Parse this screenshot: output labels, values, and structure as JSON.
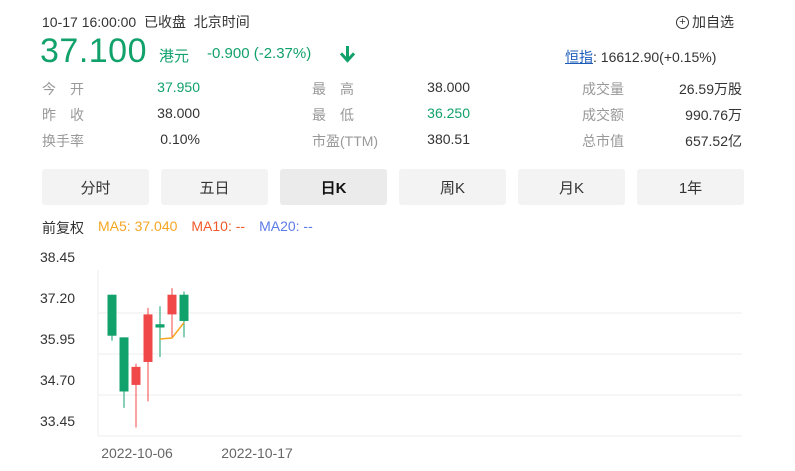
{
  "header": {
    "datetime": "10-17 16:00:00",
    "status": "已收盘",
    "tz": "北京时间",
    "watch_icon": "plus-circle-icon",
    "watch_label": "加自选"
  },
  "quote": {
    "price": "37.100",
    "currency": "港元",
    "change": "-0.900 (-2.37%)",
    "direction_icon": "arrow-down-icon",
    "index_name": "恒指",
    "index_value": ": 16612.90(+0.15%)"
  },
  "stats": [
    {
      "label": "今　开",
      "value": "37.950",
      "color": "#11a16b"
    },
    {
      "label": "最　高",
      "value": "38.000",
      "color": "#333333"
    },
    {
      "label": "成交量",
      "value": "26.59万股",
      "color": "#333333"
    },
    {
      "label": "昨　收",
      "value": "38.000",
      "color": "#333333"
    },
    {
      "label": "最　低",
      "value": "36.250",
      "color": "#11a16b"
    },
    {
      "label": "成交额",
      "value": "990.76万",
      "color": "#333333"
    },
    {
      "label": "换手率",
      "value": "0.10%",
      "color": "#333333"
    },
    {
      "label": "市盈(TTM)",
      "value": "380.51",
      "color": "#333333"
    },
    {
      "label": "总市值",
      "value": "657.52亿",
      "color": "#333333"
    }
  ],
  "tabs": [
    "分时",
    "五日",
    "日K",
    "周K",
    "月K",
    "1年"
  ],
  "active_tab": "日K",
  "legend": {
    "adjust": "前复权",
    "ma5": "MA5: 37.040",
    "ma10": "MA10: --",
    "ma20": "MA20: --"
  },
  "colors": {
    "up": "#f04848",
    "down": "#11a16b",
    "ma5": "#f5a623",
    "grid": "#eeeeee"
  },
  "chart_data": {
    "type": "candlestick",
    "y_ticks": [
      "38.45",
      "37.20",
      "35.95",
      "34.70",
      "33.45"
    ],
    "ylim": [
      33.45,
      38.45
    ],
    "x_ticks": [
      "2022-10-06",
      "2022-10-17"
    ],
    "candles": [
      {
        "open": 37.3,
        "close": 36.05,
        "high": 37.3,
        "low": 35.9
      },
      {
        "open": 36.0,
        "close": 34.35,
        "high": 36.0,
        "low": 33.85
      },
      {
        "open": 34.55,
        "close": 35.1,
        "high": 35.2,
        "low": 33.25
      },
      {
        "open": 35.25,
        "close": 36.7,
        "high": 36.9,
        "low": 34.05
      },
      {
        "open": 36.4,
        "close": 36.3,
        "high": 36.95,
        "low": 35.4
      },
      {
        "open": 36.7,
        "close": 37.3,
        "high": 37.5,
        "low": 36.0
      },
      {
        "open": 37.3,
        "close": 36.5,
        "high": 37.4,
        "low": 36.0
      }
    ],
    "ma5_line": [
      null,
      null,
      null,
      null,
      35.95,
      35.98,
      36.45
    ]
  }
}
